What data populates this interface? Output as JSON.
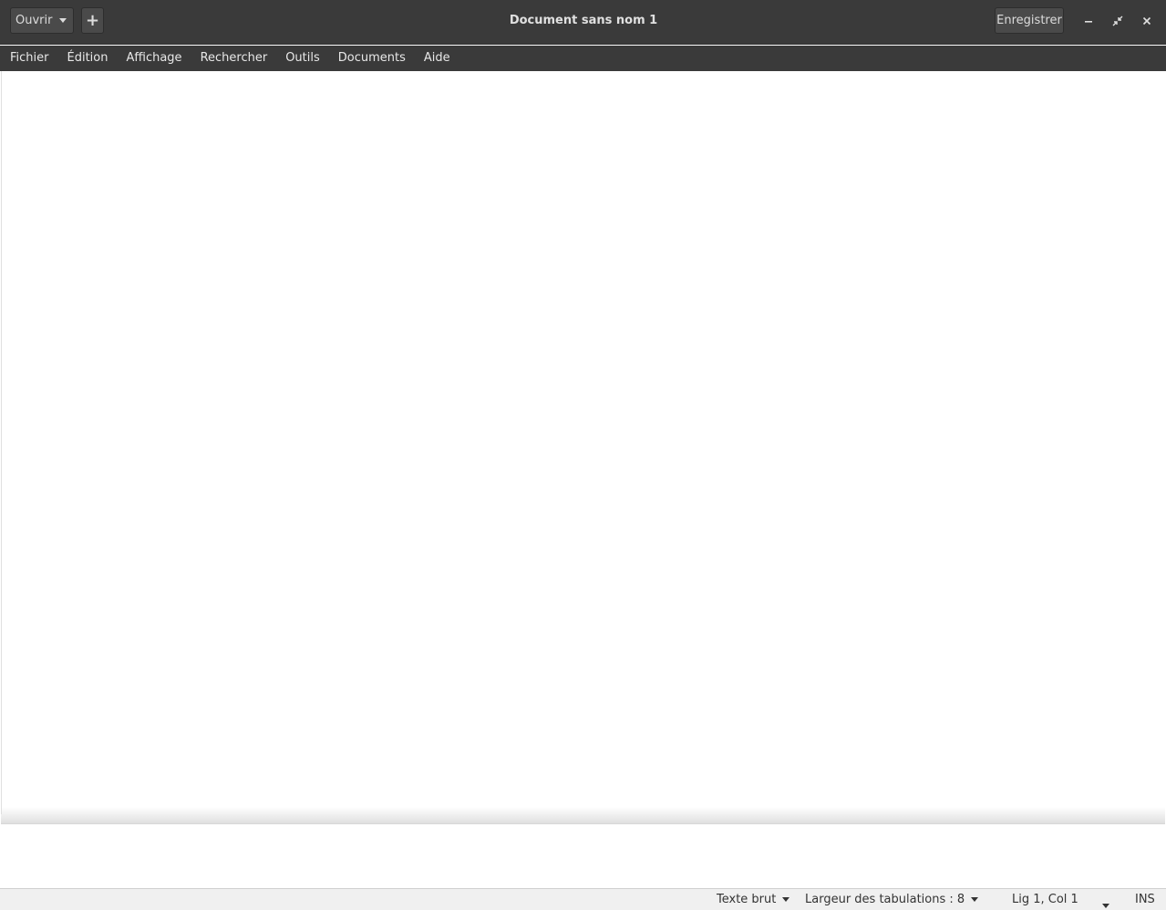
{
  "app": {
    "title": "Document sans nom 1"
  },
  "header": {
    "open_label": "Ouvrir",
    "new_tab_label": "+",
    "save_label": "Enregistrer"
  },
  "menubar": {
    "items": [
      {
        "label": "Fichier"
      },
      {
        "label": "Édition"
      },
      {
        "label": "Affichage"
      },
      {
        "label": "Rechercher"
      },
      {
        "label": "Outils"
      },
      {
        "label": "Documents"
      },
      {
        "label": "Aide"
      }
    ]
  },
  "statusbar": {
    "language": "Texte brut",
    "tab_width": "Largeur des tabulations : 8",
    "position": "Lig 1, Col 1",
    "mode": "INS"
  },
  "colors": {
    "headerbar": "#3a3a3a",
    "statusbar": "#f0f0f0",
    "editor": "#ffffff"
  }
}
